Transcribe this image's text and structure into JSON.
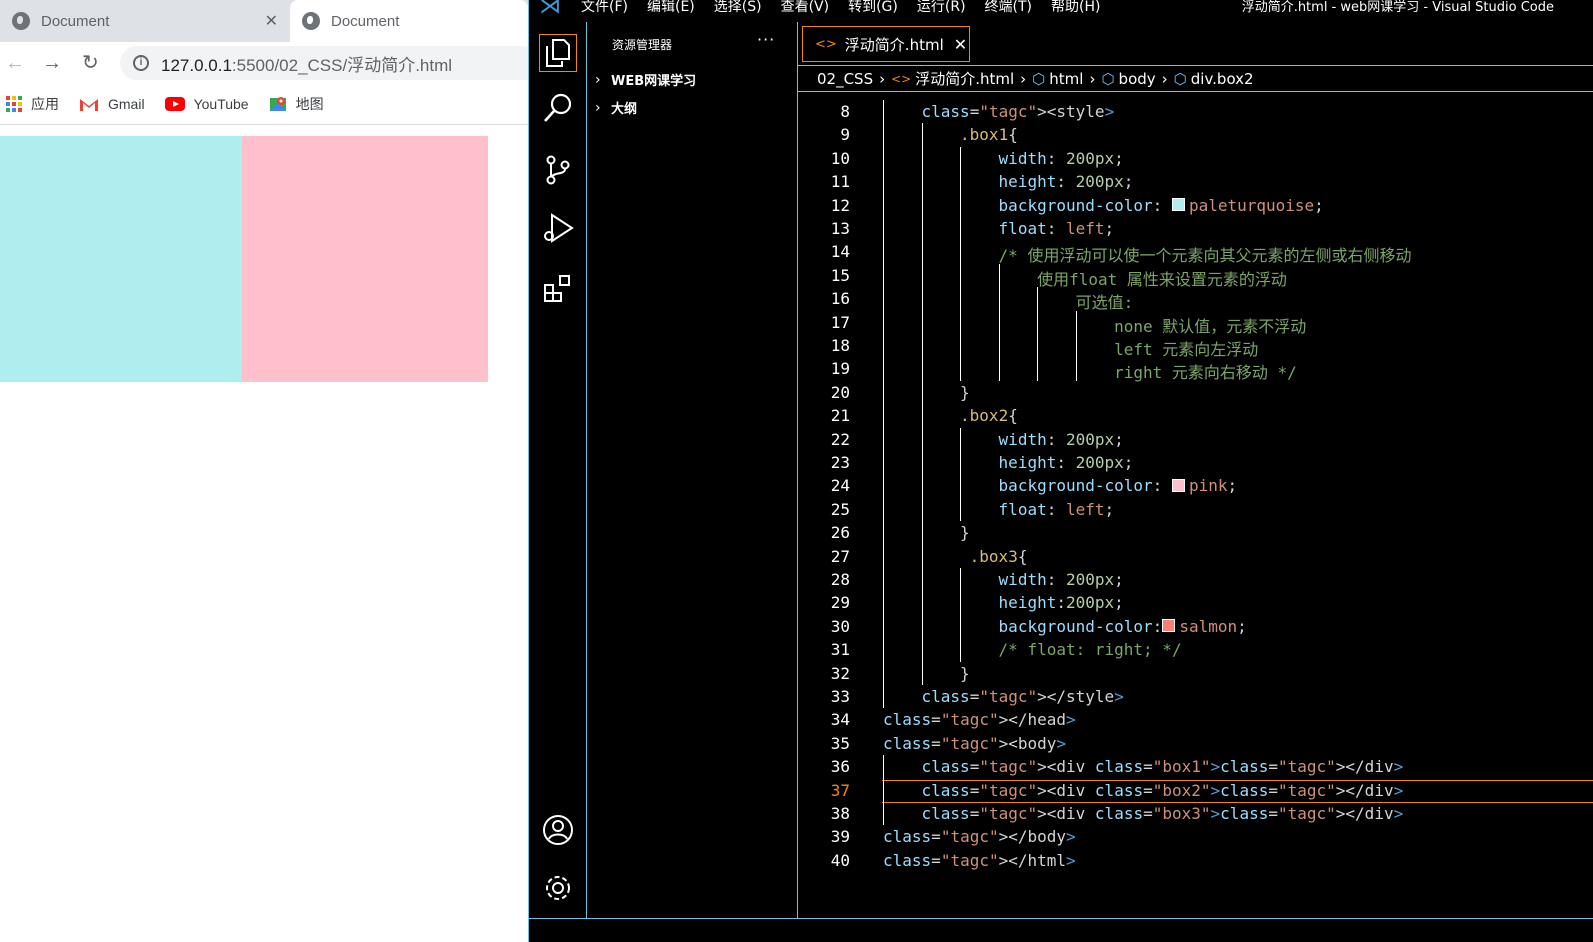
{
  "browser": {
    "tabs": [
      {
        "title": "Document",
        "close": "✕"
      },
      {
        "title": "Document"
      }
    ],
    "nav": {
      "back": "←",
      "forward": "→",
      "reload": "↻"
    },
    "address": {
      "host": "127.0.0.1",
      "path": ":5500/02_CSS/浮动简介.html"
    },
    "bookmarks": [
      {
        "label": "应用",
        "icon": "apps-grid-icon"
      },
      {
        "label": "Gmail",
        "icon": "gmail-icon"
      },
      {
        "label": "YouTube",
        "icon": "youtube-icon"
      },
      {
        "label": "地图",
        "icon": "maps-icon"
      }
    ],
    "boxes": {
      "box1_color": "#afeeee",
      "box2_color": "#ffc0cb"
    }
  },
  "vscode": {
    "menus": [
      "文件(F)",
      "编辑(E)",
      "选择(S)",
      "查看(V)",
      "转到(G)",
      "运行(R)",
      "终端(T)",
      "帮助(H)"
    ],
    "window_title": "浮动简介.html - web网课学习 - Visual Studio Code",
    "sidebar": {
      "title": "资源管理器",
      "more": "···",
      "sections": [
        "WEB网课学习",
        "大纲"
      ]
    },
    "tab": {
      "label": "浮动简介.html",
      "close": "✕"
    },
    "breadcrumb": [
      "02_CSS",
      "浮动简介.html",
      "html",
      "body",
      "div.box2"
    ],
    "active_line": 37,
    "accent": "#f38518",
    "border": "#6fc3df"
  }
}
